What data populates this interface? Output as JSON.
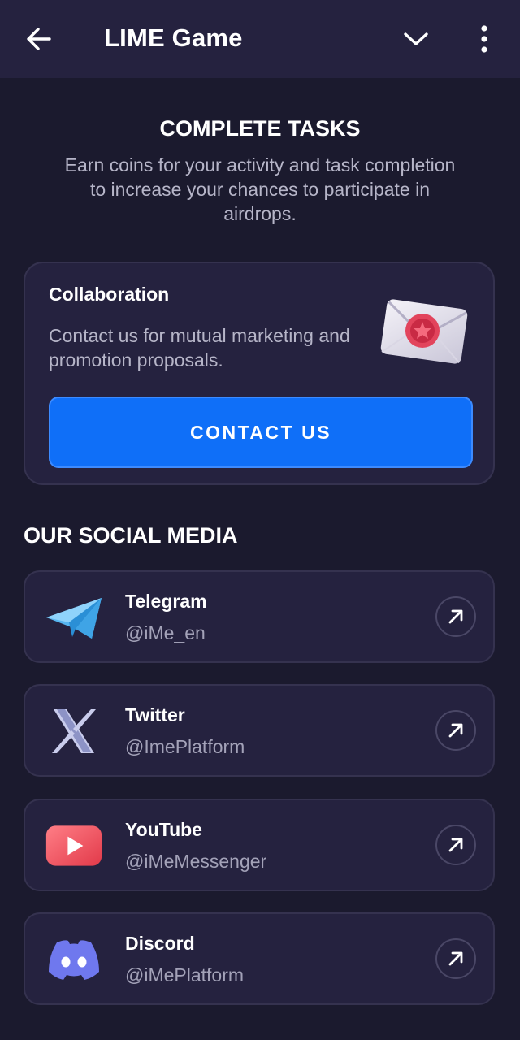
{
  "header": {
    "title": "LIME Game",
    "back_icon": "arrow-left-icon",
    "dropdown_icon": "chevron-down-icon",
    "menu_icon": "more-vertical-icon"
  },
  "tasks": {
    "heading": "COMPLETE TASKS",
    "description": "Earn coins for your activity and task completion to increase your chances to participate in airdrops."
  },
  "collaboration": {
    "title": "Collaboration",
    "description": "Contact us for mutual marketing and promotion proposals.",
    "button_label": "CONTACT US",
    "illustration": "envelope-icon"
  },
  "social": {
    "heading": "OUR SOCIAL MEDIA",
    "items": [
      {
        "name": "Telegram",
        "handle": "@iMe_en",
        "icon": "telegram-icon"
      },
      {
        "name": "Twitter",
        "handle": "@ImePlatform",
        "icon": "x-twitter-icon"
      },
      {
        "name": "YouTube",
        "handle": "@iMeMessenger",
        "icon": "youtube-icon"
      },
      {
        "name": "Discord",
        "handle": "@iMePlatform",
        "icon": "discord-icon"
      }
    ]
  },
  "colors": {
    "background": "#1b1a2e",
    "card": "#25223f",
    "accent": "#0f6ff8"
  }
}
